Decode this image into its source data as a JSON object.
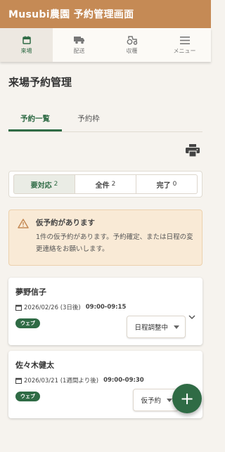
{
  "app": {
    "title": "Musubi農園 予約管理画面"
  },
  "nav": [
    {
      "label": "来場",
      "icon": "calendar-icon"
    },
    {
      "label": "配送",
      "icon": "truck-icon"
    },
    {
      "label": "収穫",
      "icon": "tractor-icon"
    },
    {
      "label": "メニュー",
      "icon": "menu-icon"
    }
  ],
  "page": {
    "title": "来場予約管理"
  },
  "tabs": [
    {
      "label": "予約一覧"
    },
    {
      "label": "予約枠"
    }
  ],
  "filters": [
    {
      "label": "要対応",
      "count": "2"
    },
    {
      "label": "全件",
      "count": "2"
    },
    {
      "label": "完了",
      "count": "0"
    }
  ],
  "alert": {
    "title": "仮予約があります",
    "message": "1件の仮予約があります。予約確定、または日程の変更連絡をお願いします。"
  },
  "reservations": [
    {
      "name": "夢野信子",
      "date": "2026/02/26 (3日後)",
      "time": "09:00-09:15",
      "channel": "ウェブ",
      "status": "日程調整中"
    },
    {
      "name": "佐々木健太",
      "date": "2026/03/21 (1週間より後)",
      "time": "09:00-09:30",
      "channel": "ウェブ",
      "status": "仮予約"
    }
  ],
  "colors": {
    "brand": "#c58a55",
    "accent": "#2f6b45",
    "alert_bg": "#f9ead6"
  },
  "fab": {
    "label": "+"
  }
}
